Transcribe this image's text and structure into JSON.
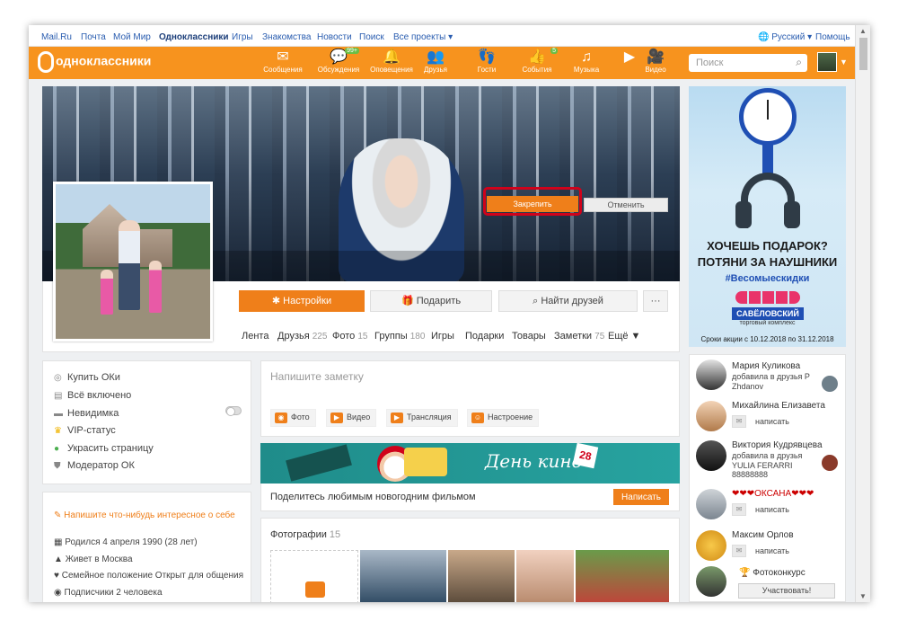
{
  "topnav": {
    "links": [
      "Mail.Ru",
      "Почта",
      "Мой Мир",
      "Одноклассники",
      "Игры",
      "Знакомства",
      "Новости",
      "Поиск",
      "Все проекты ▾"
    ],
    "language": "Русский ▾",
    "help": "Помощь"
  },
  "header": {
    "logo_text": "одноклассники",
    "nav": [
      {
        "label": "Сообщения",
        "icon": "envelope-icon",
        "glyph": "✉",
        "badge": ""
      },
      {
        "label": "Обсуждения",
        "icon": "chat-icon",
        "glyph": "💬",
        "badge": "99+"
      },
      {
        "label": "Оповещения",
        "icon": "bell-icon",
        "glyph": "🔔",
        "badge": ""
      },
      {
        "label": "Друзья",
        "icon": "friends-icon",
        "glyph": "👥",
        "badge": ""
      },
      {
        "label": "Гости",
        "icon": "footprints-icon",
        "glyph": "👣",
        "badge": ""
      },
      {
        "label": "События",
        "icon": "events-icon",
        "glyph": "👍",
        "badge": "5"
      },
      {
        "label": "Музыка",
        "icon": "music-icon",
        "glyph": "♫",
        "badge": ""
      },
      {
        "label": "",
        "icon": "play-icon",
        "glyph": "▶",
        "badge": ""
      },
      {
        "label": "Видео",
        "icon": "video-icon",
        "glyph": "🎥",
        "badge": ""
      }
    ],
    "search_placeholder": "Поиск"
  },
  "cover": {
    "pin_button": "Закрепить",
    "cancel_button": "Отменить"
  },
  "actions": {
    "settings": "Настройки",
    "gift": "Подарить",
    "find_friends": "Найти друзей",
    "more": "···"
  },
  "tabs": [
    {
      "label": "Лента",
      "count": ""
    },
    {
      "label": "Друзья",
      "count": "225"
    },
    {
      "label": "Фото",
      "count": "15"
    },
    {
      "label": "Группы",
      "count": "180"
    },
    {
      "label": "Игры",
      "count": ""
    },
    {
      "label": "Подарки",
      "count": ""
    },
    {
      "label": "Товары",
      "count": ""
    },
    {
      "label": "Заметки",
      "count": "75"
    },
    {
      "label": "Ещё ▼",
      "count": ""
    }
  ],
  "left_menu": [
    {
      "label": "Купить ОКи",
      "icon": "ok-coin-icon",
      "glyph": "◎"
    },
    {
      "label": "Всё включено",
      "icon": "all-inclusive-icon",
      "glyph": "▤"
    },
    {
      "label": "Невидимка",
      "icon": "invisible-hat-icon",
      "glyph": "▬"
    },
    {
      "label": "VIP-статус",
      "icon": "crown-icon",
      "glyph": "♛"
    },
    {
      "label": "Украсить страницу",
      "icon": "palette-icon",
      "glyph": "●"
    },
    {
      "label": "Модератор ОК",
      "icon": "shield-icon",
      "glyph": "⛊"
    }
  ],
  "about": {
    "prompt": "Напишите что-нибудь интересное о себе",
    "born": "Родился 4 апреля 1990 (28 лет)",
    "lives": "Живет в Москва",
    "family": "Семейное положение Открыт для общения",
    "subscribers": "Подписчики 2 человека"
  },
  "note": {
    "placeholder": "Напишите заметку",
    "buttons": [
      "Фото",
      "Видео",
      "Трансляция",
      "Настроение"
    ]
  },
  "promo": {
    "banner_title": "День кино",
    "banner_date": "28",
    "text": "Поделитесь любимым новогодним фильмом",
    "button": "Написать"
  },
  "photos": {
    "title": "Фотографии",
    "count": "15"
  },
  "ad": {
    "line1": "ХОЧЕШЬ ПОДАРОК?",
    "line2": "ПОТЯНИ ЗА НАУШНИКИ",
    "hashtag": "#Весомыескидки",
    "brand": "САВЁЛОВСКИЙ",
    "brand_sub": "торговый комплекс",
    "dates": "Сроки акции с 10.12.2018 по 31.12.2018"
  },
  "friends": [
    {
      "name": "Мария Куликова",
      "sub1": "добавила в друзья Р",
      "sub2": "Zhdanov",
      "action": ""
    },
    {
      "name": "Михайлина Елизавета",
      "sub1": "",
      "sub2": "",
      "action": "написать"
    },
    {
      "name": "Виктория Кудрявцева",
      "sub1": "добавила в друзья",
      "sub2": "YULIA FERARRI 88888888",
      "action": ""
    },
    {
      "name": "❤❤❤ОКСАНА❤❤❤",
      "sub1": "",
      "sub2": "",
      "action": "написать"
    },
    {
      "name": "Максим Орлов",
      "sub1": "",
      "sub2": "",
      "action": "написать"
    }
  ],
  "contest": {
    "title": "Фотоконкурс",
    "button": "Участвовать!"
  },
  "colors": {
    "accent": "#ef7f1a",
    "header": "#f7931e",
    "highlight_outline": "#d0021b",
    "link": "#2a5db0"
  }
}
